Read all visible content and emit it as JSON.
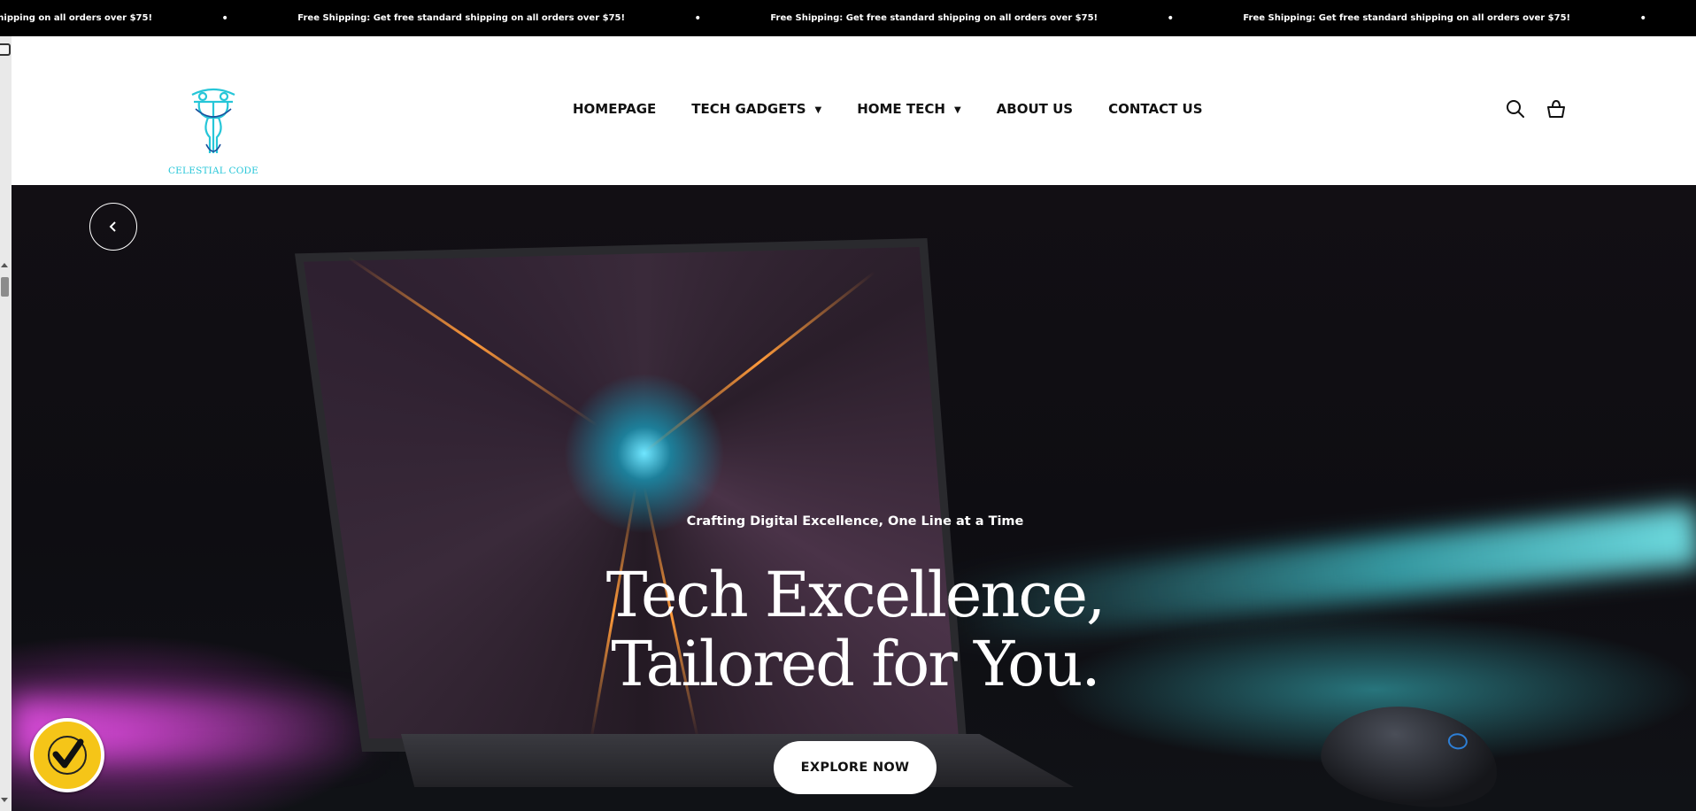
{
  "announcement": {
    "partial_message": "andard shipping on all orders over $75!",
    "message": "Free Shipping: Get free standard shipping on all orders over $75!",
    "separator": "•"
  },
  "header": {
    "logo_text": "CELESTIAL CODE",
    "nav": [
      {
        "label": "HOMEPAGE",
        "has_dropdown": false
      },
      {
        "label": "TECH GADGETS",
        "has_dropdown": true
      },
      {
        "label": "HOME TECH",
        "has_dropdown": true
      },
      {
        "label": "ABOUT US",
        "has_dropdown": false
      },
      {
        "label": "CONTACT US",
        "has_dropdown": false
      }
    ],
    "icons": [
      "search-icon",
      "cart-icon"
    ]
  },
  "hero": {
    "eyebrow": "Crafting Digital Excellence, One Line at a Time",
    "headline_line1": "Tech Excellence,",
    "headline_line2": "Tailored for You.",
    "cta_label": "EXPLORE NOW"
  },
  "colors": {
    "announcement_bg": "#000000",
    "logo_accent": "#26c6d8",
    "cta_bg": "#ffffff",
    "norton_badge": "#f5c518"
  }
}
